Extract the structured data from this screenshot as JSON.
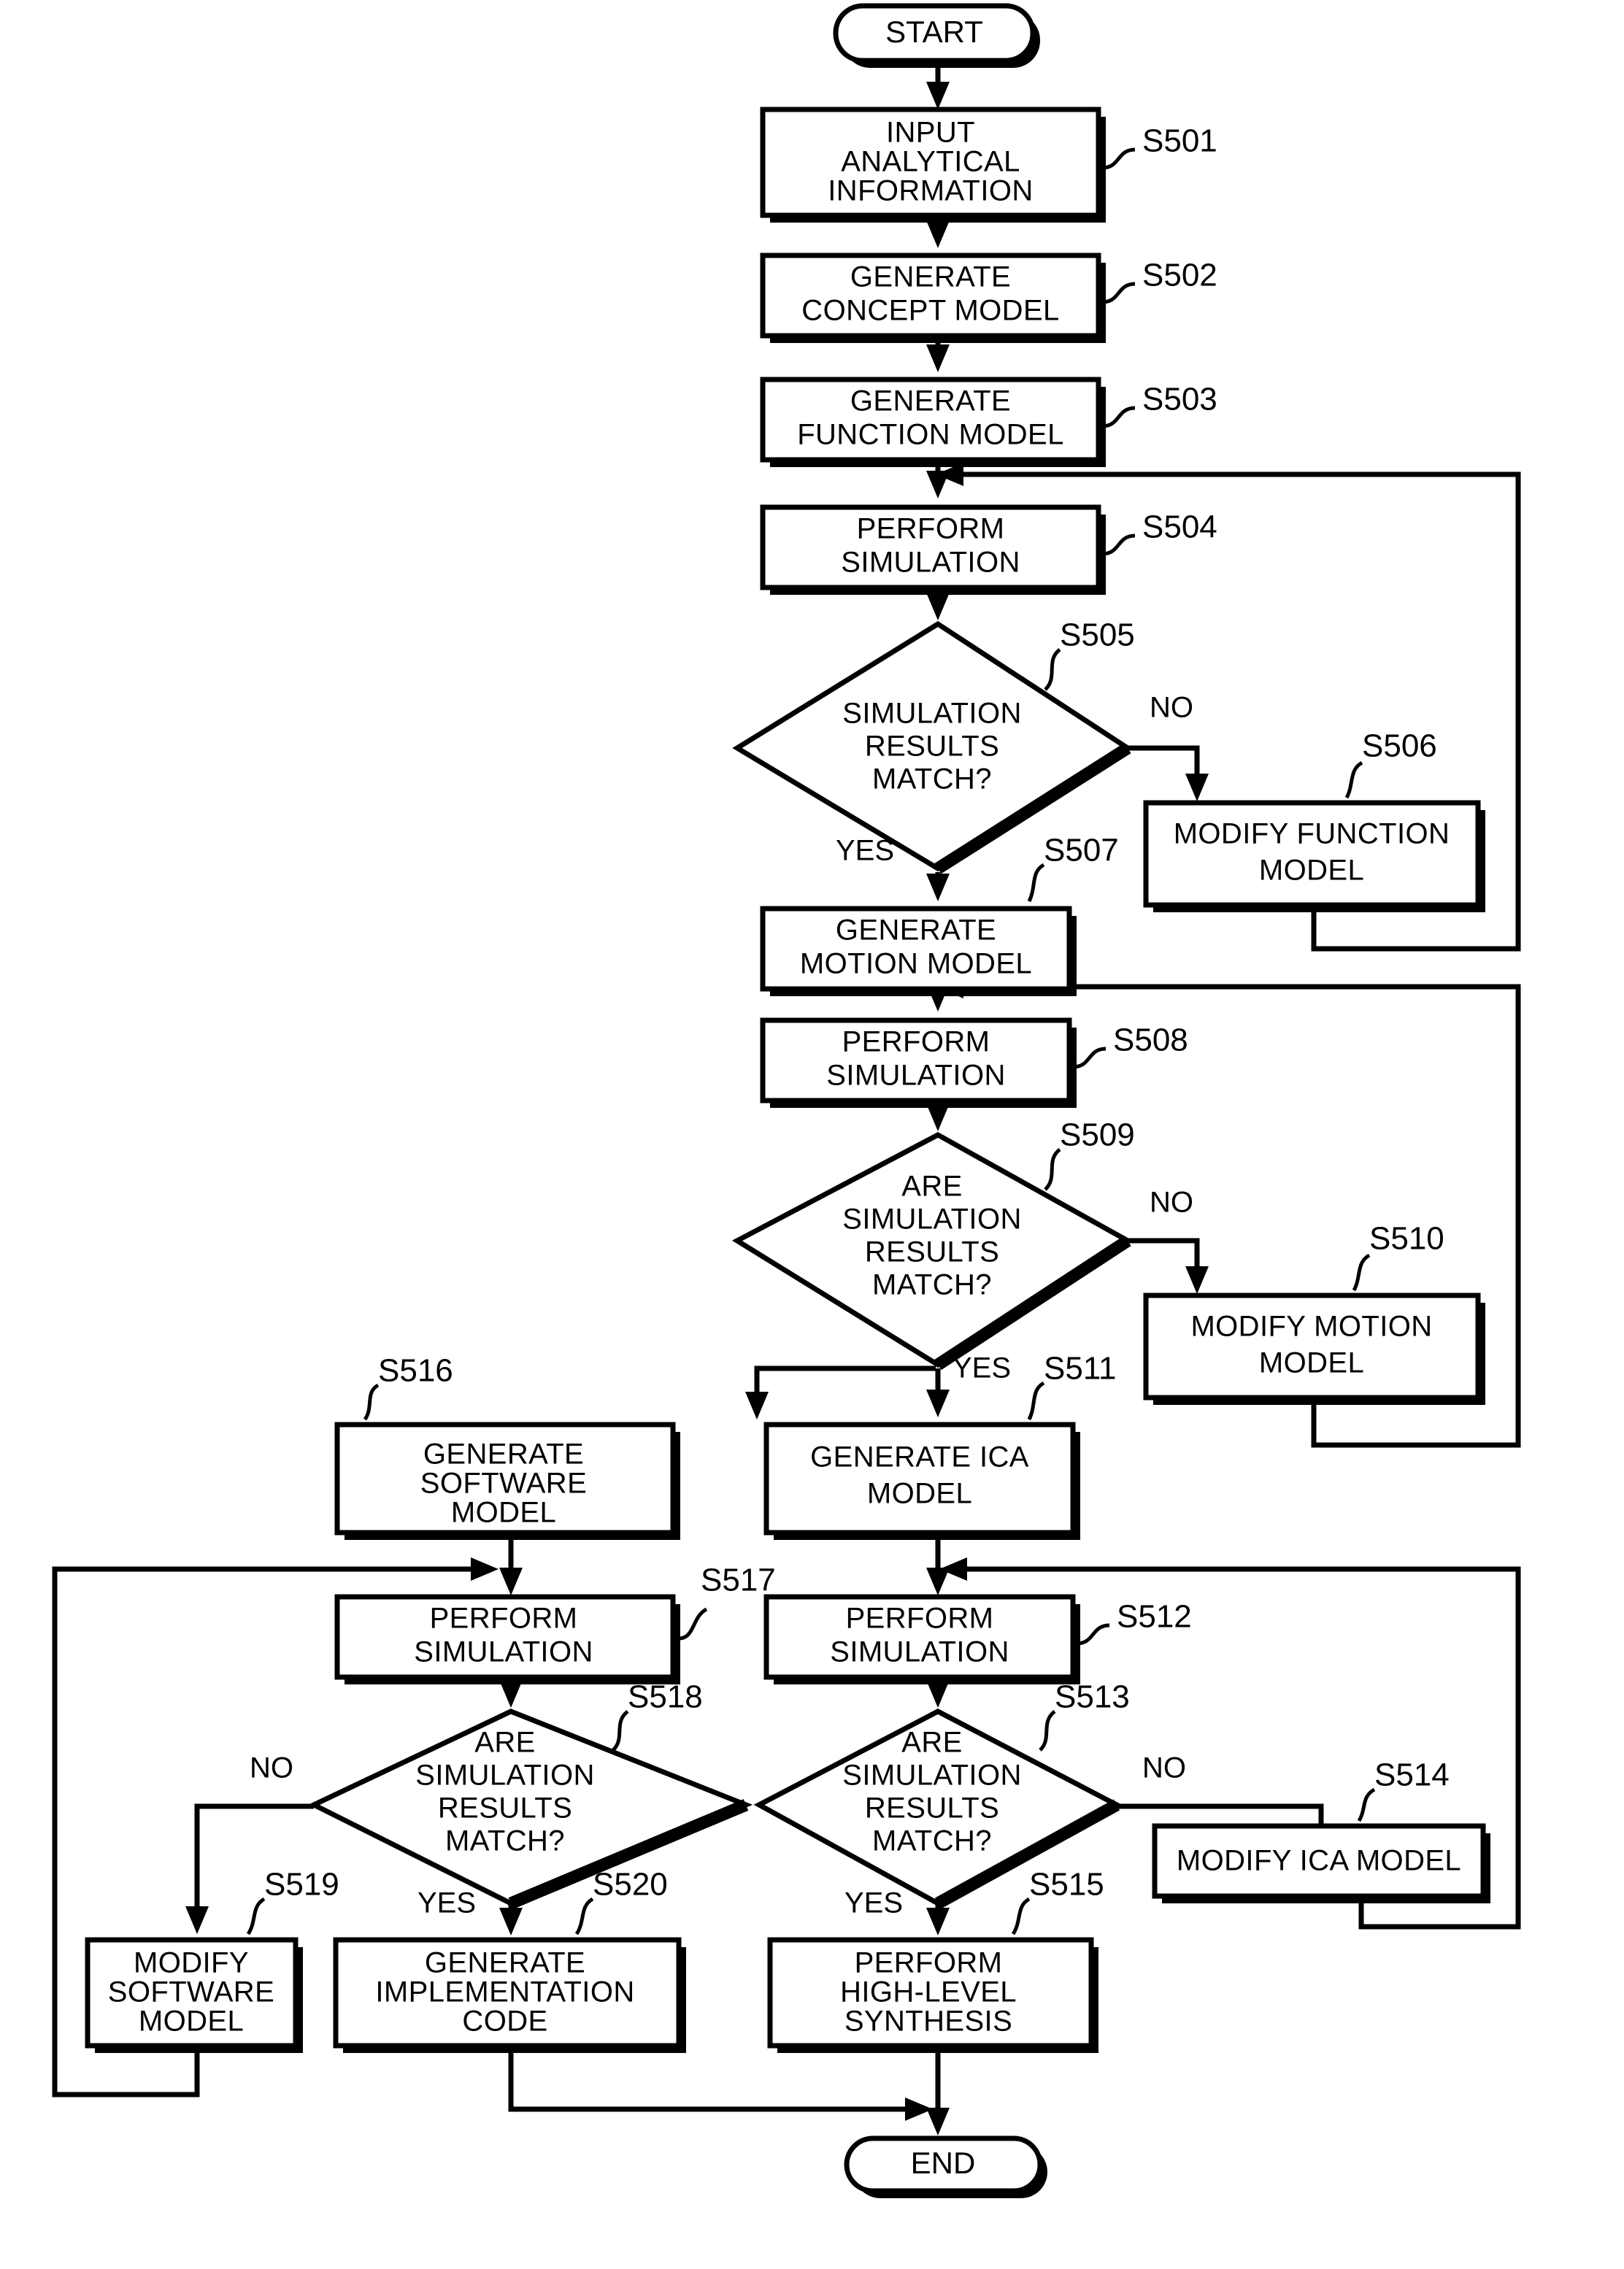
{
  "diagram": {
    "type": "flowchart",
    "title": "",
    "terminators": {
      "start": "START",
      "end": "END"
    },
    "yes_label": "YES",
    "no_label": "NO",
    "nodes": [
      {
        "id": "S501",
        "ref": "S501",
        "shape": "process",
        "lines": [
          "INPUT",
          "ANALYTICAL",
          "INFORMATION"
        ]
      },
      {
        "id": "S502",
        "ref": "S502",
        "shape": "process",
        "lines": [
          "GENERATE",
          "CONCEPT MODEL"
        ]
      },
      {
        "id": "S503",
        "ref": "S503",
        "shape": "process",
        "lines": [
          "GENERATE",
          "FUNCTION MODEL"
        ]
      },
      {
        "id": "S504",
        "ref": "S504",
        "shape": "process",
        "lines": [
          "PERFORM",
          "SIMULATION"
        ]
      },
      {
        "id": "S505",
        "ref": "S505",
        "shape": "decision",
        "lines": [
          "SIMULATION",
          "RESULTS",
          "MATCH?"
        ]
      },
      {
        "id": "S506",
        "ref": "S506",
        "shape": "process",
        "lines": [
          "MODIFY FUNCTION",
          "MODEL"
        ]
      },
      {
        "id": "S507",
        "ref": "S507",
        "shape": "process",
        "lines": [
          "GENERATE",
          "MOTION MODEL"
        ]
      },
      {
        "id": "S508",
        "ref": "S508",
        "shape": "process",
        "lines": [
          "PERFORM",
          "SIMULATION"
        ]
      },
      {
        "id": "S509",
        "ref": "S509",
        "shape": "decision",
        "lines": [
          "ARE",
          "SIMULATION",
          "RESULTS",
          "MATCH?"
        ]
      },
      {
        "id": "S510",
        "ref": "S510",
        "shape": "process",
        "lines": [
          "MODIFY MOTION",
          "MODEL"
        ]
      },
      {
        "id": "S511",
        "ref": "S511",
        "shape": "process",
        "lines": [
          "GENERATE ICA",
          "MODEL"
        ]
      },
      {
        "id": "S512",
        "ref": "S512",
        "shape": "process",
        "lines": [
          "PERFORM",
          "SIMULATION"
        ]
      },
      {
        "id": "S513",
        "ref": "S513",
        "shape": "decision",
        "lines": [
          "ARE",
          "SIMULATION",
          "RESULTS",
          "MATCH?"
        ]
      },
      {
        "id": "S514",
        "ref": "S514",
        "shape": "process",
        "lines": [
          "MODIFY ICA MODEL"
        ]
      },
      {
        "id": "S515",
        "ref": "S515",
        "shape": "process",
        "lines": [
          "PERFORM",
          "HIGH-LEVEL",
          "SYNTHESIS"
        ]
      },
      {
        "id": "S516",
        "ref": "S516",
        "shape": "process",
        "lines": [
          "GENERATE",
          "SOFTWARE",
          "MODEL"
        ]
      },
      {
        "id": "S517",
        "ref": "S517",
        "shape": "process",
        "lines": [
          "PERFORM",
          "SIMULATION"
        ]
      },
      {
        "id": "S518",
        "ref": "S518",
        "shape": "decision",
        "lines": [
          "ARE",
          "SIMULATION",
          "RESULTS",
          "MATCH?"
        ]
      },
      {
        "id": "S519",
        "ref": "S519",
        "shape": "process",
        "lines": [
          "MODIFY",
          "SOFTWARE",
          "MODEL"
        ]
      },
      {
        "id": "S520",
        "ref": "S520",
        "shape": "process",
        "lines": [
          "GENERATE",
          "IMPLEMENTATION",
          "CODE"
        ]
      }
    ],
    "colors": {
      "line": "#000000",
      "fill": "#ffffff",
      "shadow": "#000000"
    }
  }
}
